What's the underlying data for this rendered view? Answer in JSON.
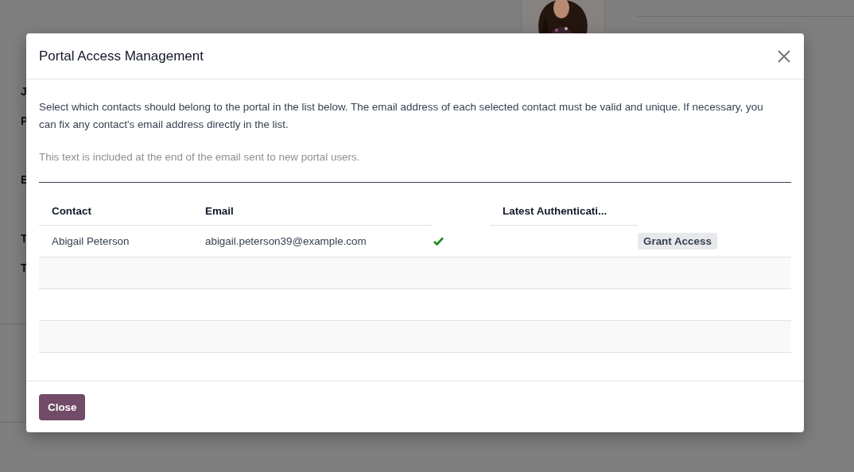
{
  "background": {
    "field_labels": [
      {
        "kind": "label",
        "text": "J"
      },
      {
        "kind": "label",
        "text": "P"
      },
      {
        "kind": "covered"
      },
      {
        "kind": "label",
        "text": "E"
      },
      {
        "kind": "covered"
      },
      {
        "kind": "label",
        "text": "T"
      },
      {
        "kind": "label",
        "text": "T"
      }
    ]
  },
  "dialog": {
    "title": "Portal Access Management",
    "description": "Select which contacts should belong to the portal in the list below. The email address of each selected contact must be valid and unique. If necessary, you can fix any contact's email address directly in the list.",
    "note": {
      "placeholder": "This text is included at the end of the email sent to new portal users."
    },
    "table": {
      "columns": [
        "Contact",
        "Email",
        "Latest Authenticati..."
      ],
      "rows": [
        {
          "contact": "Abigail Peterson",
          "email": "abigail.peterson39@example.com",
          "email_valid": true,
          "action": "Grant Access"
        }
      ]
    },
    "buttons": [
      "Close"
    ]
  }
}
